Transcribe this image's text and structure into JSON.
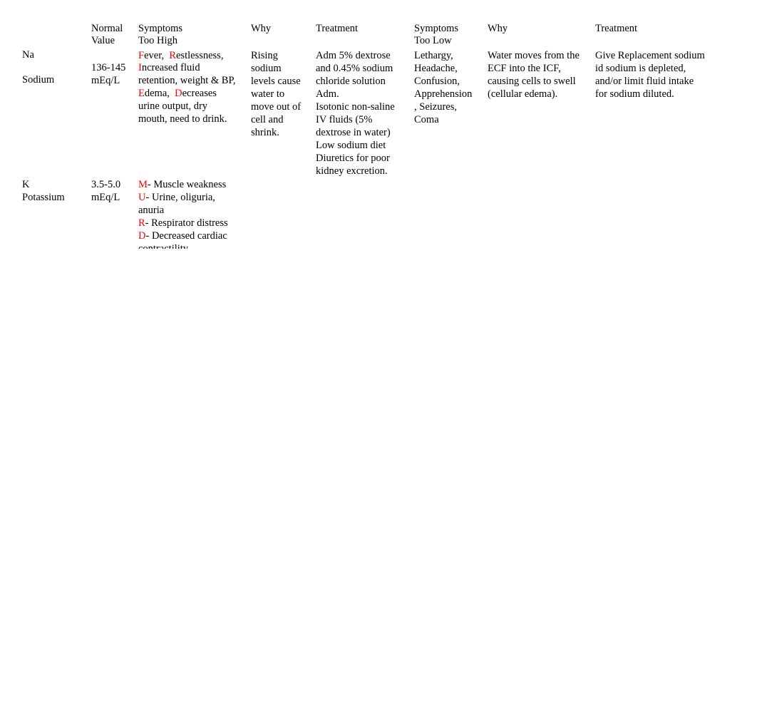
{
  "headers": {
    "normal_value": [
      "Normal",
      "Value"
    ],
    "symptoms_high": [
      "Symptoms",
      "Too High"
    ],
    "why_high": "Why",
    "treatment_high": "Treatment",
    "symptoms_low": [
      "Symptoms",
      "Too Low"
    ],
    "why_low": "Why",
    "treatment_low": "Treatment"
  },
  "accent_color": "#ff0000",
  "rows": {
    "sodium": {
      "symbol": "Na",
      "name": "Sodium",
      "normal_value": [
        "136-145",
        "mEq/L"
      ],
      "symptoms_high": {
        "l1_a": "F",
        "l1_b": "ever,  ",
        "l1_c": "R",
        "l1_d": "estlessness,",
        "l2_a": "I",
        "l2_b": "ncreased fluid",
        "l3": "retention, weight & BP,",
        "l4_a": "E",
        "l4_b": "dema,  ",
        "l4_c": "D",
        "l4_d": "ecreases",
        "l5": "urine output, dry",
        "l6": "mouth, need to drink."
      },
      "why_high": [
        "Rising",
        "sodium",
        "levels cause",
        "water to",
        "move out of",
        "cell and",
        "shrink."
      ],
      "treatment_high": [
        "Adm 5% dextrose",
        "and 0.45% sodium",
        "chloride solution",
        "Adm.",
        "Isotonic non-saline",
        "IV fluids (5%",
        "dextrose in water)",
        "Low sodium diet",
        "Diuretics for poor",
        "kidney excretion."
      ],
      "symptoms_low": [
        "Lethargy,",
        "Headache,",
        "Confusion,",
        "Apprehension",
        ", Seizures,",
        "Coma"
      ],
      "why_low": [
        "Water moves from the",
        "ECF into the ICF,",
        "causing cells to swell",
        "(cellular edema)."
      ],
      "treatment_low": [
        "Give Replacement sodium",
        "id sodium is depleted,",
        "and/or limit fluid intake",
        "for sodium diluted."
      ]
    },
    "potassium": {
      "symbol": "K",
      "name": "Potassium",
      "normal_value": [
        "3.5-5.0",
        "mEq/L"
      ],
      "symptoms_high": [
        {
          "letter": "M",
          "text": "- Muscle weakness"
        },
        {
          "letter": "U",
          "text": "- Urine, oliguria,"
        },
        {
          "letter": "",
          "text": "anuria"
        },
        {
          "letter": "R",
          "text": "- Respirator distress"
        },
        {
          "letter": "D",
          "text": "- Decreased cardiac"
        },
        {
          "letter": "",
          "text": "contractility"
        }
      ]
    }
  }
}
